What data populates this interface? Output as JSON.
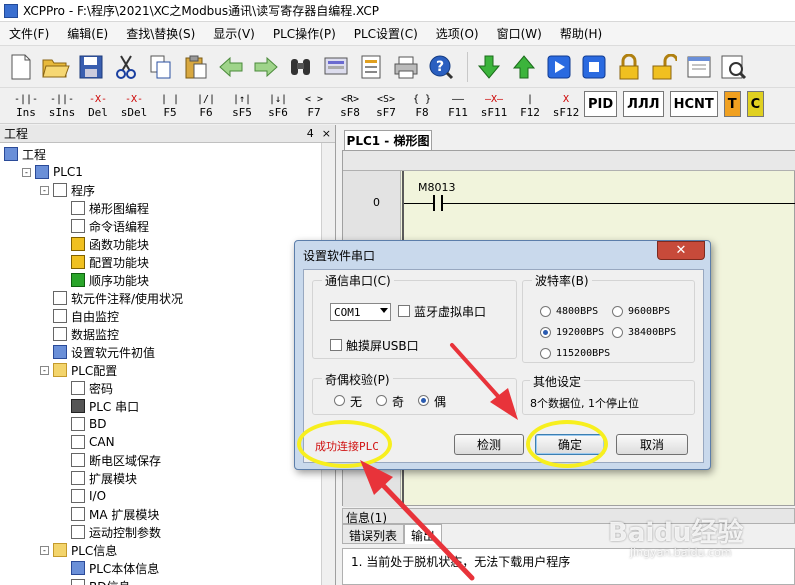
{
  "window": {
    "title": "XCPPro - F:\\程序\\2021\\XC之Modbus通讯\\读写寄存器自编程.XCP"
  },
  "menu": [
    "文件(F)",
    "编辑(E)",
    "查找\\替换(S)",
    "显示(V)",
    "PLC操作(P)",
    "PLC设置(C)",
    "选项(O)",
    "窗口(W)",
    "帮助(H)"
  ],
  "toolbar": {
    "icons": [
      "new-file-icon",
      "open-folder-icon",
      "save-icon",
      "cut-icon",
      "copy-icon",
      "paste-icon",
      "undo-icon",
      "redo-icon",
      "find-icon",
      "monitor-icon",
      "report-icon",
      "print-icon",
      "help-icon",
      "download-icon",
      "upload-icon",
      "run-icon",
      "stop-icon",
      "lock-icon",
      "unlock-icon",
      "window-icon",
      "preview-icon"
    ],
    "ladder_buttons": [
      {
        "sym": "-||-",
        "label": "Ins"
      },
      {
        "sym": "-||-",
        "label": "sIns"
      },
      {
        "sym": "-X-",
        "label": "Del"
      },
      {
        "sym": "-X-",
        "label": "sDel"
      },
      {
        "sym": "| |",
        "label": "F5"
      },
      {
        "sym": "|/|",
        "label": "F6"
      },
      {
        "sym": "|↑|",
        "label": "sF5"
      },
      {
        "sym": "|↓|",
        "label": "sF6"
      },
      {
        "sym": "< >",
        "label": "F7"
      },
      {
        "sym": "<R>",
        "label": "sF8"
      },
      {
        "sym": "<S>",
        "label": "sF7"
      },
      {
        "sym": "{ }",
        "label": "F8"
      },
      {
        "sym": "——",
        "label": "F11"
      },
      {
        "sym": "—X—",
        "label": "sF11"
      },
      {
        "sym": "|",
        "label": "F12"
      },
      {
        "sym": "X",
        "label": "sF12"
      }
    ],
    "big_buttons": [
      "PID",
      "ЛЛЛ",
      "HCNT",
      "T",
      "C"
    ]
  },
  "project_panel": {
    "title": "工程",
    "pin": "4",
    "close": "×",
    "items": [
      {
        "label": "工程",
        "indent": 0,
        "icon": "project-icon"
      },
      {
        "label": "PLC1",
        "indent": 1,
        "icon": "plc-icon",
        "expander": "-"
      },
      {
        "label": "程序",
        "indent": 2,
        "icon": "program-icon",
        "expander": "-"
      },
      {
        "label": "梯形图编程",
        "indent": 3,
        "icon": "ladder-icon"
      },
      {
        "label": "命令语编程",
        "indent": 3,
        "icon": "instruction-icon"
      },
      {
        "label": "函数功能块",
        "indent": 3,
        "icon": "function-block-icon"
      },
      {
        "label": "配置功能块",
        "indent": 3,
        "icon": "config-block-icon"
      },
      {
        "label": "顺序功能块",
        "indent": 3,
        "icon": "sequence-block-icon"
      },
      {
        "label": "软元件注释/使用状况",
        "indent": 2,
        "icon": "comment-icon"
      },
      {
        "label": "自由监控",
        "indent": 2,
        "icon": "free-monitor-icon"
      },
      {
        "label": "数据监控",
        "indent": 2,
        "icon": "data-monitor-icon"
      },
      {
        "label": "设置软元件初值",
        "indent": 2,
        "icon": "init-value-icon"
      },
      {
        "label": "PLC配置",
        "indent": 2,
        "icon": "folder-icon",
        "expander": "-"
      },
      {
        "label": "密码",
        "indent": 3,
        "icon": "password-icon"
      },
      {
        "label": "PLC 串口",
        "indent": 3,
        "icon": "serial-port-icon"
      },
      {
        "label": "BD",
        "indent": 3,
        "icon": "bd-icon"
      },
      {
        "label": "CAN",
        "indent": 3,
        "icon": "can-icon"
      },
      {
        "label": "断电区域保存",
        "indent": 3,
        "icon": "power-save-icon"
      },
      {
        "label": "扩展模块",
        "indent": 3,
        "icon": "expansion-icon"
      },
      {
        "label": "I/O",
        "indent": 3,
        "icon": "io-icon"
      },
      {
        "label": "MA 扩展模块",
        "indent": 3,
        "icon": "ma-icon"
      },
      {
        "label": "运动控制参数",
        "indent": 3,
        "icon": "motion-icon"
      },
      {
        "label": "PLC信息",
        "indent": 2,
        "icon": "folder-icon",
        "expander": "-"
      },
      {
        "label": "PLC本体信息",
        "indent": 3,
        "icon": "info-icon"
      },
      {
        "label": "BD信息",
        "indent": 3,
        "icon": "bd-info-icon"
      }
    ]
  },
  "editor": {
    "tab": "PLC1 - 梯形图",
    "rung_number": "0",
    "contact_label": "M8013"
  },
  "info_panel": {
    "title": "信息(1)",
    "tabs": [
      "错误列表",
      "输出"
    ],
    "message": "1. 当前处于脱机状态，无法下载用户程序"
  },
  "dialog": {
    "title": "设置软件串口",
    "close": "✕",
    "comm_port": {
      "title": "通信串口(C)",
      "selected": "COM1",
      "bluetooth": "蓝牙虚拟串口",
      "touch_usb": "触摸屏USB口"
    },
    "baud_rate": {
      "title": "波特率(B)",
      "options": [
        "4800BPS",
        "9600BPS",
        "19200BPS",
        "38400BPS",
        "115200BPS"
      ],
      "selected": "19200BPS"
    },
    "parity": {
      "title": "奇偶校验(P)",
      "options": [
        "无",
        "奇",
        "偶"
      ],
      "selected": "偶"
    },
    "other": {
      "title": "其他设定",
      "text": "8个数据位, 1个停止位"
    },
    "status": "成功连接PLC",
    "detect_button": "检测",
    "ok_button": "确定",
    "cancel_button": "取消"
  },
  "watermark": {
    "main": "Baidu经验",
    "sub": "jingyan.baidu.com"
  },
  "colors": {
    "highlight": "#f7ef1e",
    "arrow": "#e8333a",
    "success": "#d01010",
    "ladder_bg": "#f1f4dc"
  }
}
